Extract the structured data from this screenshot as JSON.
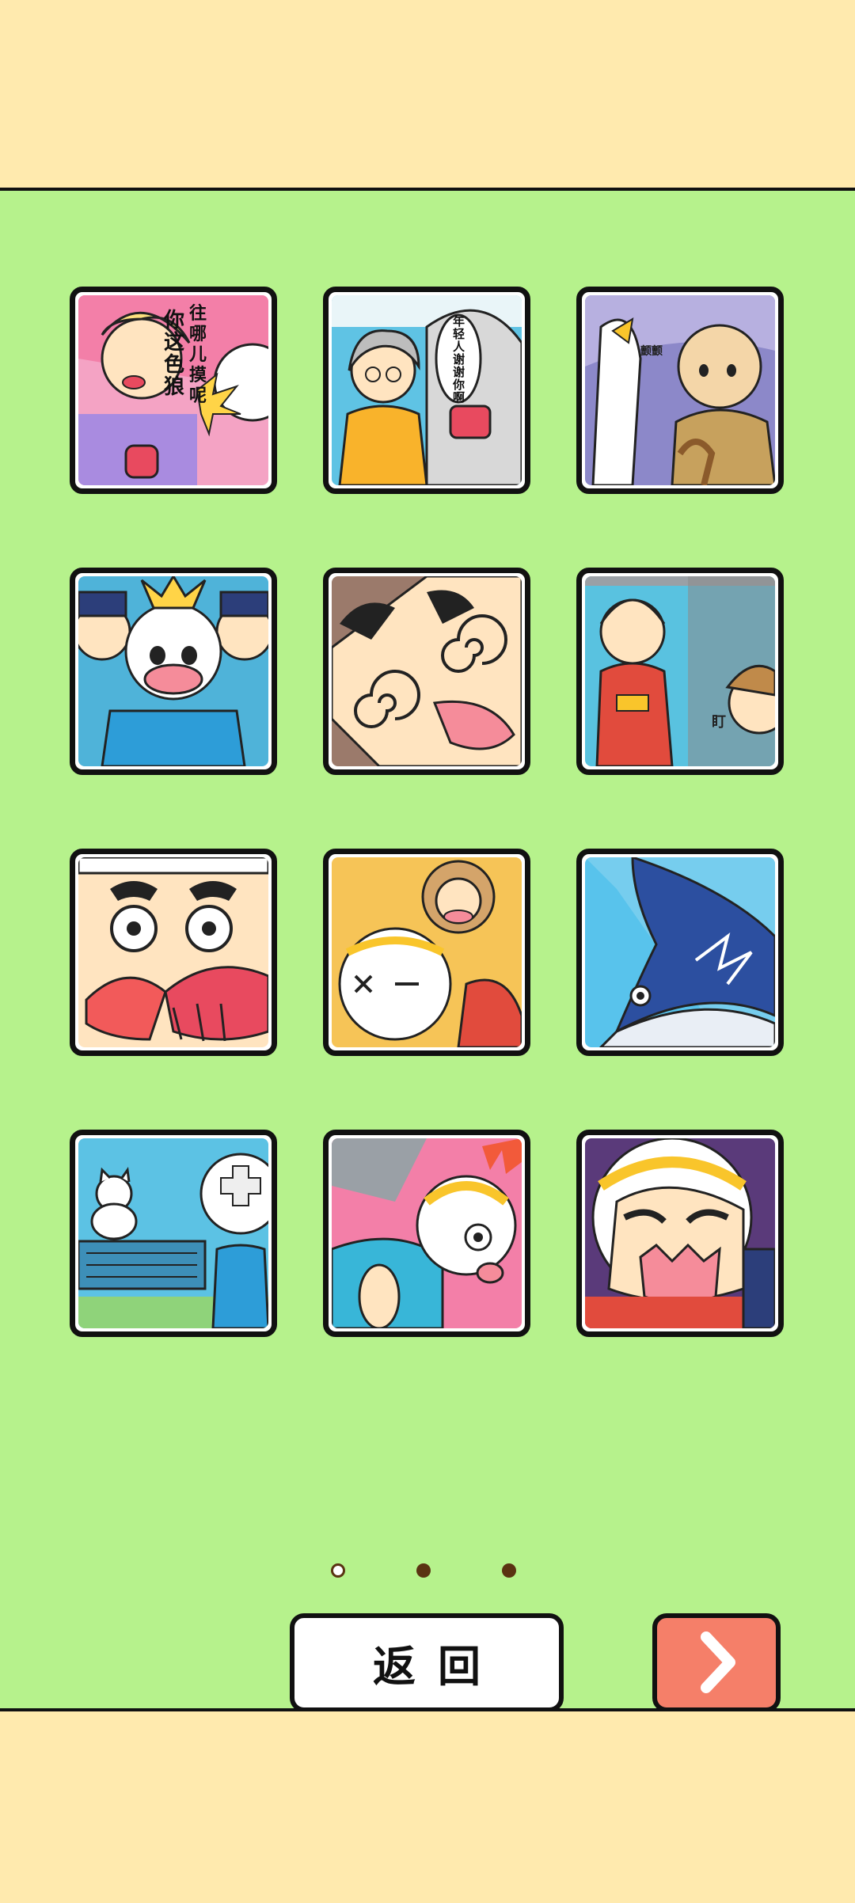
{
  "level_grid": {
    "tiles": [
      {
        "id": "scene-1",
        "bubble": "往哪儿摸呢你这色狼"
      },
      {
        "id": "scene-2",
        "bubble": "年轻人谢谢你啊"
      },
      {
        "id": "scene-3",
        "bubble": "颤颤"
      },
      {
        "id": "scene-4"
      },
      {
        "id": "scene-5"
      },
      {
        "id": "scene-6",
        "bubble": "盯"
      },
      {
        "id": "scene-7"
      },
      {
        "id": "scene-8"
      },
      {
        "id": "scene-9"
      },
      {
        "id": "scene-10"
      },
      {
        "id": "scene-11"
      },
      {
        "id": "scene-12"
      }
    ]
  },
  "pagination": {
    "total_pages": 3,
    "current_page": 1
  },
  "buttons": {
    "back_label": "返回",
    "next_icon": "chevron-right-icon"
  },
  "colors": {
    "stage_bg": "#B6F28C",
    "band_bg": "#FFEAAE",
    "next_button": "#F57F69",
    "dot": "#5A3312"
  }
}
